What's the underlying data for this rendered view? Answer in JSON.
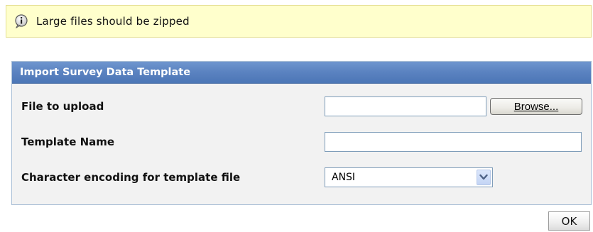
{
  "notice": {
    "text": "Large files should be zipped",
    "icon": "info-icon"
  },
  "panel": {
    "title": "Import Survey Data Template",
    "fields": {
      "file": {
        "label": "File to upload",
        "value": "",
        "browse_label": "Browse..."
      },
      "template_name": {
        "label": "Template Name",
        "value": ""
      },
      "encoding": {
        "label": "Character encoding for template file",
        "selected": "ANSI",
        "arrow_icon": "chevron-down-icon"
      }
    }
  },
  "actions": {
    "ok_label": "OK"
  },
  "colors": {
    "notice_bg": "#ffffcc",
    "header_bg": "#5a82c0",
    "panel_bg": "#f2f2f2"
  }
}
